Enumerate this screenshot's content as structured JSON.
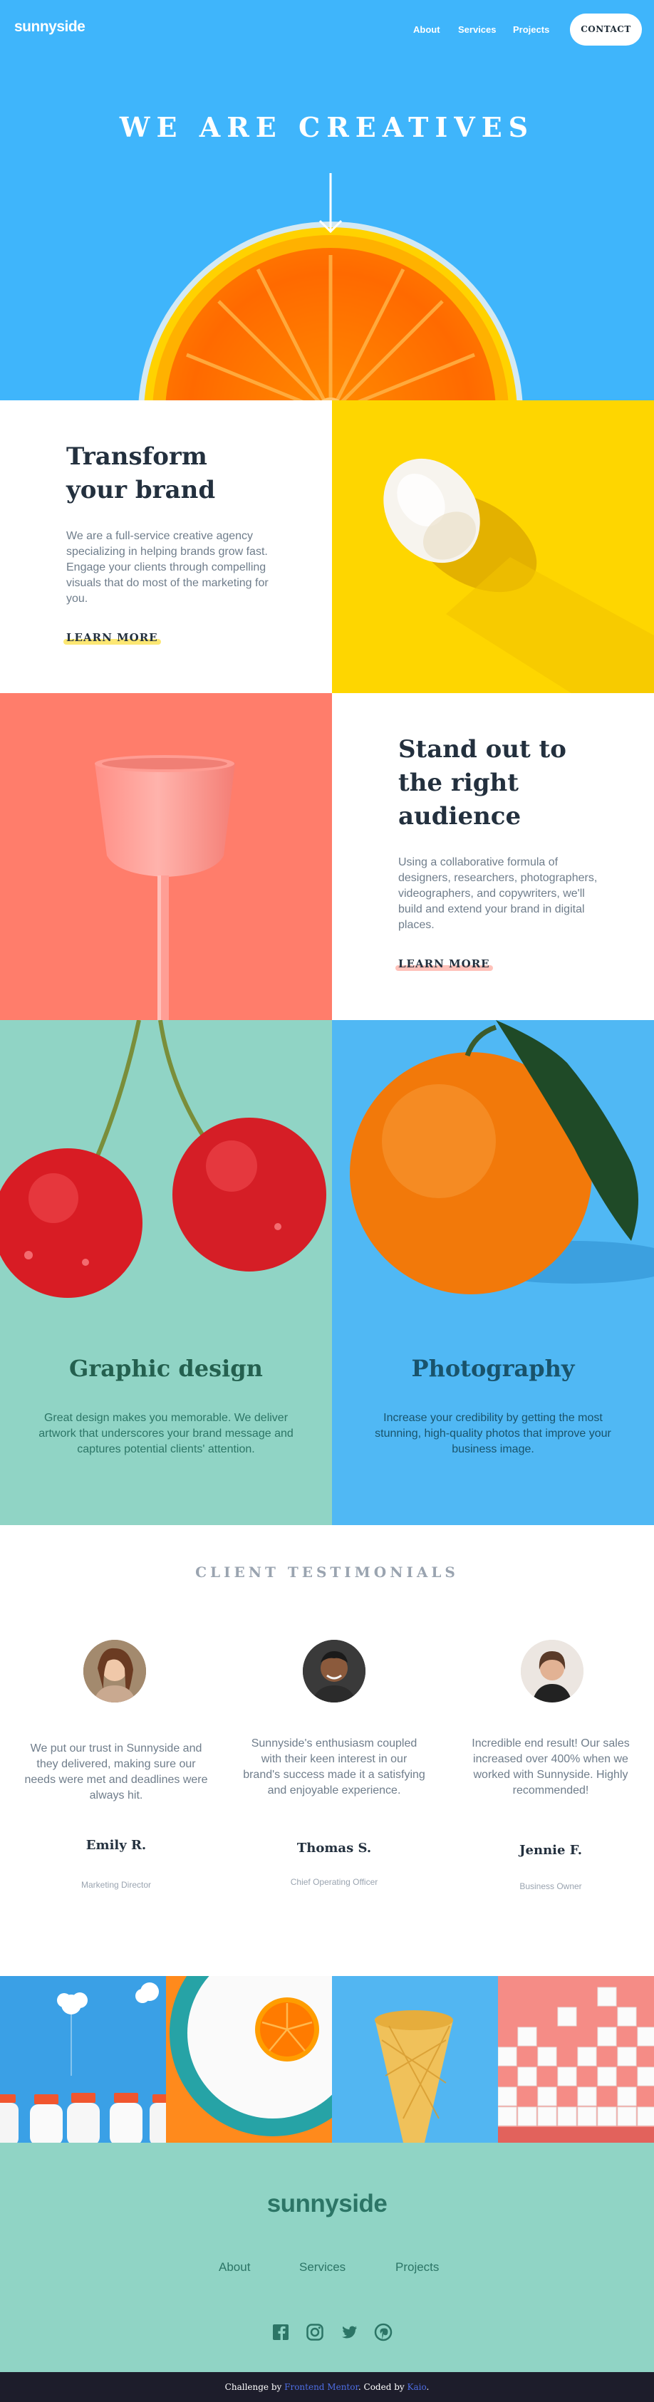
{
  "header": {
    "logo": "sunnyside",
    "nav": [
      "About",
      "Services",
      "Projects"
    ],
    "contact": "CONTACT"
  },
  "hero": {
    "title": "WE ARE CREATIVES",
    "arrow_icon": "arrow-down-icon"
  },
  "transform": {
    "title_line1": "Transform",
    "title_line2": "your brand",
    "body": "We are a full-service creative agency specializing in helping brands grow fast. Engage your clients through compelling visuals that do most of the marketing for you.",
    "cta": "LEARN MORE",
    "accent": "#fad400",
    "image": "egg-on-yellow"
  },
  "standout": {
    "title_line1": "Stand out to",
    "title_line2": "the right",
    "title_line3": "audience",
    "body": "Using a collaborative formula of designers, researchers, photographers, videographers, and copywriters, we'll build and extend your brand in digital places.",
    "cta": "LEARN MORE",
    "accent": "#fe7865",
    "image": "pink-cup-on-coral"
  },
  "services": [
    {
      "title": "Graphic design",
      "body": "Great design makes you memorable. We deliver artwork that underscores your brand message and captures potential clients' attention.",
      "title_color": "#24604f",
      "text_color": "#2c7566",
      "image": "cherries-on-teal"
    },
    {
      "title": "Photography",
      "body": "Increase your credibility by getting the most stunning, high-quality photos that improve your business image.",
      "title_color": "#19536b",
      "text_color": "#19536b",
      "image": "orange-on-blue"
    }
  ],
  "testimonials": {
    "heading": "CLIENT TESTIMONIALS",
    "items": [
      {
        "quote": "We put our trust in Sunnyside and they delivered, making sure our needs were met and deadlines were always hit.",
        "name": "Emily R.",
        "role": "Marketing Director"
      },
      {
        "quote": "Sunnyside's enthusiasm coupled with their keen interest in our brand's success made it a satisfying and enjoyable experience.",
        "name": "Thomas S.",
        "role": "Chief Operating Officer"
      },
      {
        "quote": "Incredible end result! Our sales increased over 400% when we worked with Sunnyside. Highly recommended!",
        "name": "Jennie F.",
        "role": "Business Owner"
      }
    ]
  },
  "gallery": [
    "milk-bottles",
    "orange-on-plate",
    "ice-cream-cone",
    "sugar-cubes"
  ],
  "footer": {
    "logo": "sunnyside",
    "links": [
      "About",
      "Services",
      "Projects"
    ],
    "social": [
      "facebook-icon",
      "instagram-icon",
      "twitter-icon",
      "pinterest-icon"
    ]
  },
  "attribution": {
    "prefix": "Challenge by",
    "fm": "Frontend Mentor",
    "mid": ". Coded by",
    "author": "Kaio",
    "suffix": "."
  }
}
